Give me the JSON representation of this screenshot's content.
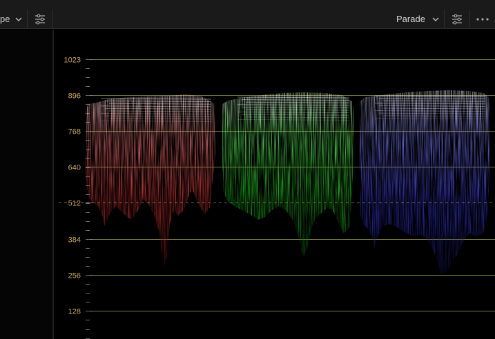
{
  "toolbar": {
    "scope_selector_label": "pe",
    "mode_selector_label": "Parade"
  },
  "scope": {
    "type": "RGB Parade",
    "axis_labels": [
      "1023",
      "896",
      "768",
      "640",
      "512",
      "384",
      "256",
      "128"
    ],
    "axis_values": [
      1023,
      896,
      768,
      640,
      512,
      384,
      256,
      128
    ],
    "graticule_color": "#7d7a3e",
    "label_color": "#c9a860",
    "channels": [
      {
        "name": "red",
        "color": "#ff4a4a",
        "top_value": 880,
        "bottom_value": 300
      },
      {
        "name": "green",
        "color": "#3dff3d",
        "top_value": 890,
        "bottom_value": 300
      },
      {
        "name": "blue",
        "color": "#5050ff",
        "top_value": 895,
        "bottom_value": 250
      }
    ]
  },
  "icons": {
    "scope_chevron": "chevron-down-icon",
    "settings_left": "sliders-icon",
    "mode_chevron": "chevron-down-icon",
    "settings_right": "sliders-icon",
    "more": "more-horizontal-icon"
  }
}
